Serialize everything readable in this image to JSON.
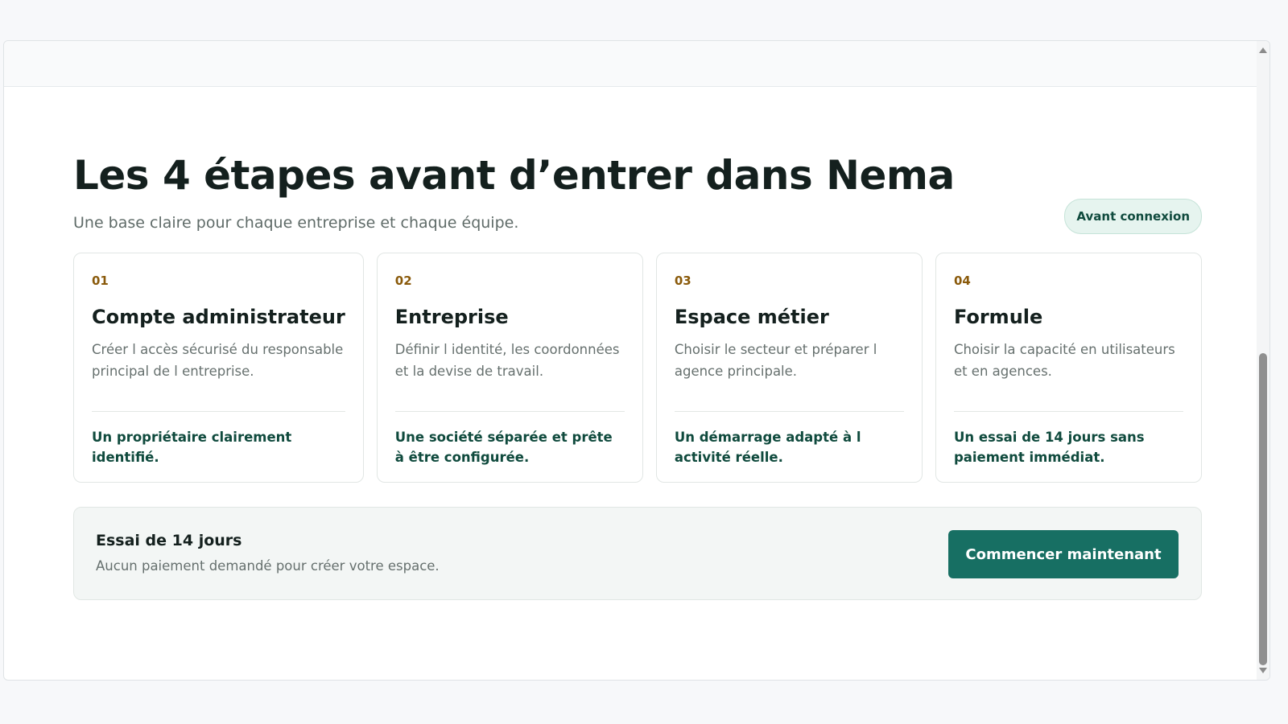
{
  "header": {
    "title": "Les 4 étapes avant d’entrer dans Nema",
    "subtitle": "Une base claire pour chaque entreprise et chaque équipe.",
    "badge": "Avant connexion"
  },
  "steps": [
    {
      "number": "01",
      "title": "Compte administrateur",
      "description": "Créer l accès sécurisé du responsable principal de l entreprise.",
      "outcome": "Un propriétaire clairement identifié."
    },
    {
      "number": "02",
      "title": "Entreprise",
      "description": "Définir l identité, les coordonnées et la devise de travail.",
      "outcome": "Une société séparée et prête à être configurée."
    },
    {
      "number": "03",
      "title": "Espace métier",
      "description": "Choisir le secteur et préparer l agence principale.",
      "outcome": "Un démarrage adapté à l activité réelle."
    },
    {
      "number": "04",
      "title": "Formule",
      "description": "Choisir la capacité en utilisateurs et en agences.",
      "outcome": "Un essai de 14 jours sans paiement immédiat."
    }
  ],
  "trial": {
    "title": "Essai de 14 jours",
    "description": "Aucun paiement demandé pour créer votre espace.",
    "button_label": "Commencer maintenant"
  },
  "colors": {
    "accent": "#176f63",
    "step_number": "#8a5a0b",
    "outcome_text": "#0f4a3d",
    "badge_background": "#e6f4ef"
  }
}
